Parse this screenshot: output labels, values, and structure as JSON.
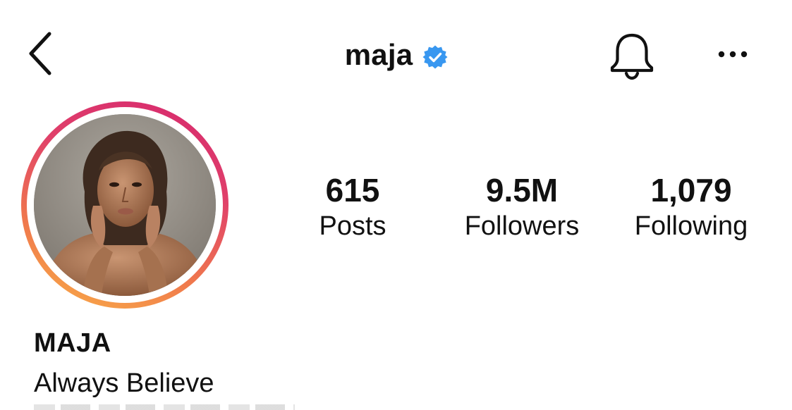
{
  "header": {
    "username": "maja",
    "verified": true,
    "icons": {
      "back": "chevron-left-icon",
      "verified": "verified-badge-icon",
      "notifications": "bell-icon",
      "more": "more-horizontal-icon"
    }
  },
  "profile": {
    "avatar": "profile-photo",
    "display_name": "MAJA",
    "bio": "Always Believe"
  },
  "stats": [
    {
      "value": "615",
      "label": "Posts"
    },
    {
      "value": "9.5M",
      "label": "Followers"
    },
    {
      "value": "1,079",
      "label": "Following"
    }
  ],
  "colors": {
    "verified_blue": "#3897f0",
    "ring_gradient": [
      "#d6286f",
      "#e0406a",
      "#f07a4c",
      "#f9b047"
    ],
    "text": "#111111",
    "background": "#ffffff"
  }
}
